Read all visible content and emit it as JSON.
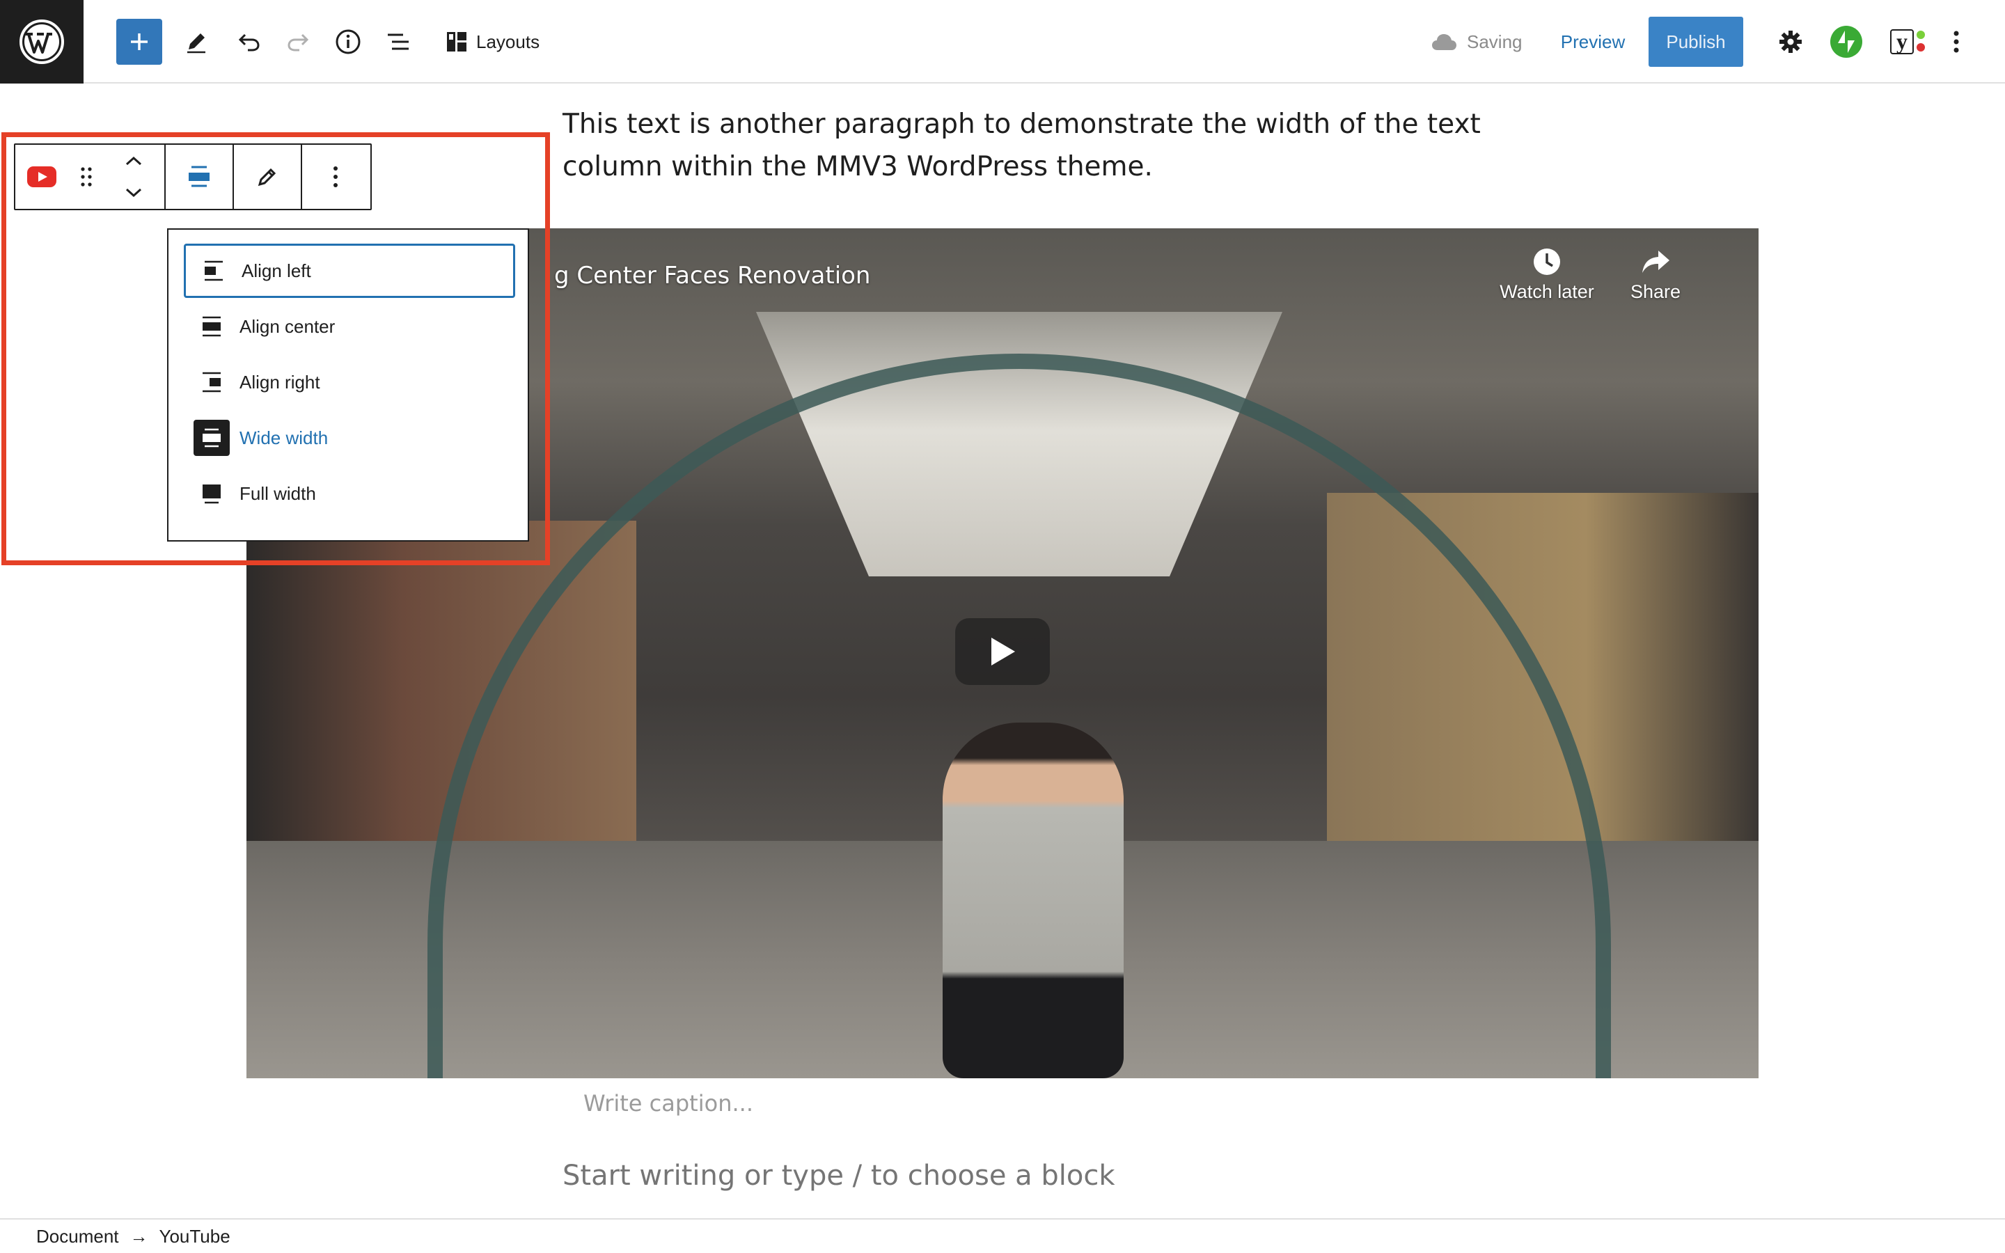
{
  "header": {
    "layouts_label": "Layouts",
    "saving_label": "Saving",
    "preview_label": "Preview",
    "publish_label": "Publish",
    "yoast_label": "y"
  },
  "content": {
    "paragraph": "This text is another paragraph to demonstrate the width of the text column within the MMV3 WordPress theme.",
    "caption_placeholder": "Write caption...",
    "appender_placeholder": "Start writing or type / to choose a block"
  },
  "video": {
    "title": "g Center Faces Renovation",
    "watch_later_label": "Watch later",
    "share_label": "Share"
  },
  "align_menu": {
    "items": [
      {
        "label": "Align left",
        "icon": "align-left-icon"
      },
      {
        "label": "Align center",
        "icon": "align-center-icon"
      },
      {
        "label": "Align right",
        "icon": "align-right-icon"
      },
      {
        "label": "Wide width",
        "icon": "wide-width-icon"
      },
      {
        "label": "Full width",
        "icon": "full-width-icon"
      }
    ],
    "selected": "Wide width",
    "focused": "Align left"
  },
  "breadcrumb": {
    "items": [
      "Document",
      "YouTube"
    ],
    "separator": "→"
  },
  "colors": {
    "accent": "#2271b1",
    "publish_bg": "#3a83c6",
    "highlight": "#e54127",
    "youtube_red": "#e52d27"
  }
}
